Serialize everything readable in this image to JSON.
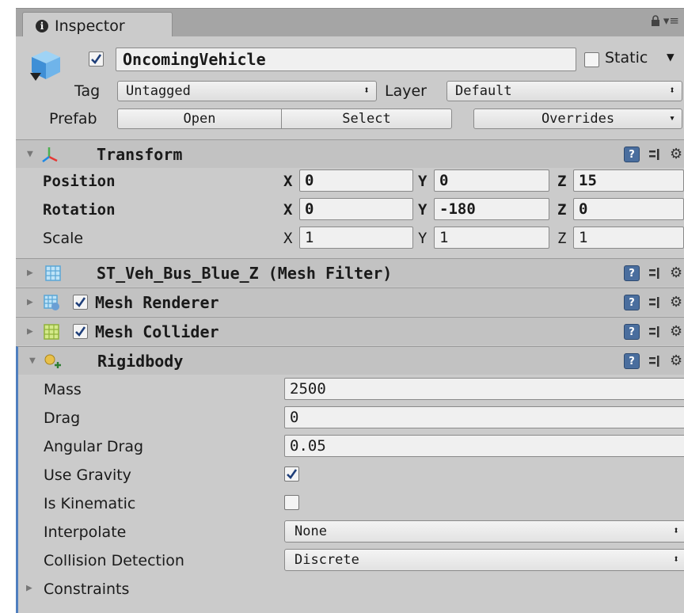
{
  "tab": {
    "title": "Inspector",
    "info_icon": "i",
    "lock_icon": "lock-icon",
    "menu_icon": "▾≡"
  },
  "object": {
    "name": "OncomingVehicle",
    "active": true,
    "static_label": "Static",
    "static_checked": false,
    "tag_label": "Tag",
    "tag_value": "Untagged",
    "layer_label": "Layer",
    "layer_value": "Default",
    "prefab_label": "Prefab",
    "prefab_open": "Open",
    "prefab_select": "Select",
    "prefab_overrides": "Overrides"
  },
  "transform": {
    "title": "Transform",
    "position": {
      "label": "Position",
      "x_label": "X",
      "y_label": "Y",
      "z_label": "Z",
      "x": "0",
      "y": "0",
      "z": "15"
    },
    "rotation": {
      "label": "Rotation",
      "x_label": "X",
      "y_label": "Y",
      "z_label": "Z",
      "x": "0",
      "y": "-180",
      "z": "0"
    },
    "scale": {
      "label": "Scale",
      "x_label": "X",
      "y_label": "Y",
      "z_label": "Z",
      "x": "1",
      "y": "1",
      "z": "1"
    }
  },
  "components": [
    {
      "title": "ST_Veh_Bus_Blue_Z (Mesh Filter)",
      "icon": "mesh-filter-icon"
    },
    {
      "title": "Mesh Renderer",
      "icon": "mesh-renderer-icon",
      "enabled": true
    },
    {
      "title": "Mesh Collider",
      "icon": "mesh-collider-icon",
      "enabled": true
    }
  ],
  "rigidbody": {
    "title": "Rigidbody",
    "mass_label": "Mass",
    "mass": "2500",
    "drag_label": "Drag",
    "drag": "0",
    "angular_drag_label": "Angular Drag",
    "angular_drag": "0.05",
    "use_gravity_label": "Use Gravity",
    "use_gravity": true,
    "is_kinematic_label": "Is Kinematic",
    "is_kinematic": false,
    "interpolate_label": "Interpolate",
    "interpolate": "None",
    "collision_label": "Collision Detection",
    "collision": "Discrete",
    "constraints_label": "Constraints"
  },
  "colors": {
    "panel": "#cbcbcb",
    "header": "#c2c2c2",
    "accent": "#4f7fbf",
    "tabbar": "#a5a5a5"
  }
}
